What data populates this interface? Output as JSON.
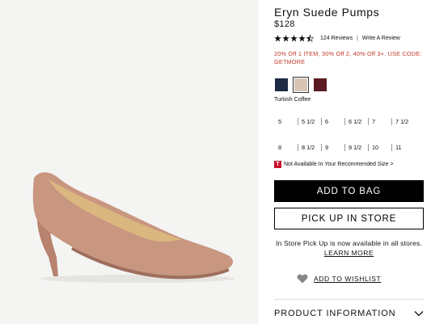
{
  "product": {
    "title": "Eryn Suede Pumps",
    "price": "$128",
    "rating_stars": 4.5,
    "reviews_label": "124 Reviews",
    "separator": "|",
    "write_review": "Write A Review",
    "promo": "20% Off 1 ITEM, 30% Off 2, 40% Off 3+. USE CODE: GETMORE"
  },
  "colors": {
    "swatches": [
      {
        "name": "navy",
        "hex": "#1f2a44"
      },
      {
        "name": "Turkish Coffee",
        "hex": "#d9c4b4"
      },
      {
        "name": "burgundy",
        "hex": "#5a1a1f"
      }
    ],
    "selected_name": "Turkish Coffee",
    "promo_color": "#c0392b",
    "suede_color": "#c99680"
  },
  "sizes": {
    "row1": [
      "5",
      "5 1/2",
      "6",
      "6 1/2",
      "7",
      "7 1/2"
    ],
    "row2": [
      "8",
      "8 1/2",
      "9",
      "9 1/2",
      "10",
      "11"
    ]
  },
  "availability": {
    "badge": "T",
    "text": "Not Available In Your Recommended Size >"
  },
  "actions": {
    "add_to_bag": "ADD TO BAG",
    "pick_up": "PICK UP IN STORE",
    "store_note": "In Store Pick Up is now available in all stores.",
    "learn_more": "LEARN MORE",
    "wishlist": "ADD TO WISHLIST"
  },
  "sections": {
    "product_information": "PRODUCT INFORMATION"
  },
  "icons": {
    "star": "star-icon",
    "heart": "heart-icon",
    "chevron": "chevron-down-icon",
    "badge": "t-badge-icon"
  }
}
